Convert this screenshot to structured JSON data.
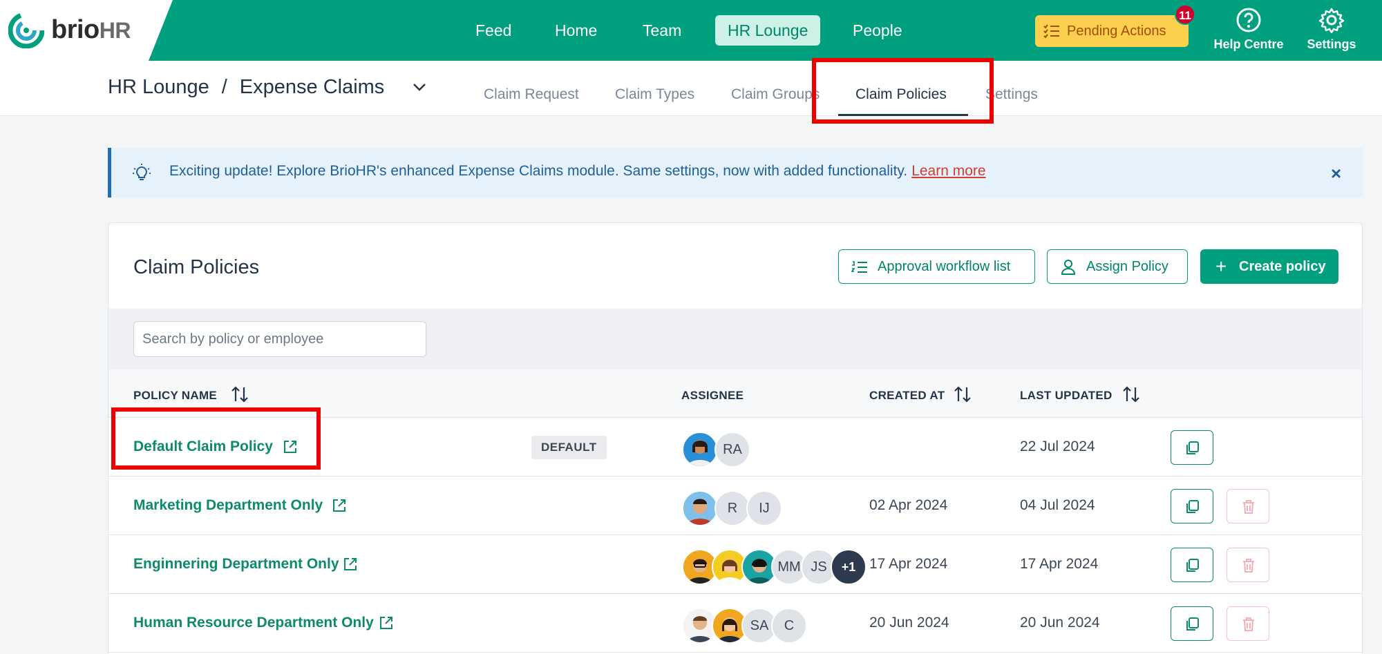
{
  "brand": {
    "name_main": "brio",
    "name_suffix": "HR"
  },
  "nav": {
    "items": [
      {
        "label": "Feed"
      },
      {
        "label": "Home"
      },
      {
        "label": "Team"
      },
      {
        "label": "HR Lounge",
        "active": true
      },
      {
        "label": "People"
      }
    ]
  },
  "toolbar": {
    "pending_label": "Pending Actions",
    "pending_count": "11",
    "help_label": "Help Centre",
    "settings_label": "Settings"
  },
  "breadcrumb": {
    "root": "HR Lounge",
    "separator": "/",
    "current": "Expense Claims"
  },
  "subtabs": [
    {
      "label": "Claim Request"
    },
    {
      "label": "Claim Types"
    },
    {
      "label": "Claim Groups"
    },
    {
      "label": "Claim Policies",
      "active": true
    },
    {
      "label": "Settings"
    }
  ],
  "banner": {
    "text": "Exciting update! Explore BrioHR's enhanced Expense Claims module. Same settings, now with added functionality.",
    "link": "Learn more",
    "close": "×"
  },
  "card": {
    "title": "Claim Policies",
    "approval_button": "Approval workflow list",
    "assign_button": "Assign Policy",
    "create_button": "Create policy",
    "create_plus": "+"
  },
  "search": {
    "placeholder": "Search by policy or employee",
    "value": ""
  },
  "table": {
    "headers": {
      "policy_name": "POLICY NAME",
      "assignee": "ASSIGNEE",
      "created_at": "CREATED AT",
      "last_updated": "LAST UPDATED"
    },
    "default_tag": "DEFAULT",
    "rows": [
      {
        "name": "Default Claim Policy",
        "is_default": true,
        "avatars": [
          "photo-woman-1",
          "RA"
        ],
        "created_at": "",
        "last_updated": "22 Jul 2024"
      },
      {
        "name": "Marketing Department Only",
        "avatars": [
          "photo-man-1",
          "R",
          "IJ"
        ],
        "created_at": "02 Apr 2024",
        "last_updated": "04 Jul 2024"
      },
      {
        "name": "Enginnering Department Only",
        "avatars": [
          "photo-man-2",
          "photo-woman-2",
          "photo-woman-3",
          "MM",
          "JS",
          "+1"
        ],
        "created_at": "17 Apr 2024",
        "last_updated": "17 Apr 2024"
      },
      {
        "name": "Human Resource Department Only",
        "avatars": [
          "photo-man-3",
          "photo-woman-4",
          "SA",
          "C"
        ],
        "created_at": "20 Jun 2024",
        "last_updated": "20 Jun 2024"
      }
    ]
  },
  "colors": {
    "brand": "#00a07f",
    "pending": "#fbd04f",
    "highlight": "#ee0000",
    "link": "#0d8a6b"
  }
}
